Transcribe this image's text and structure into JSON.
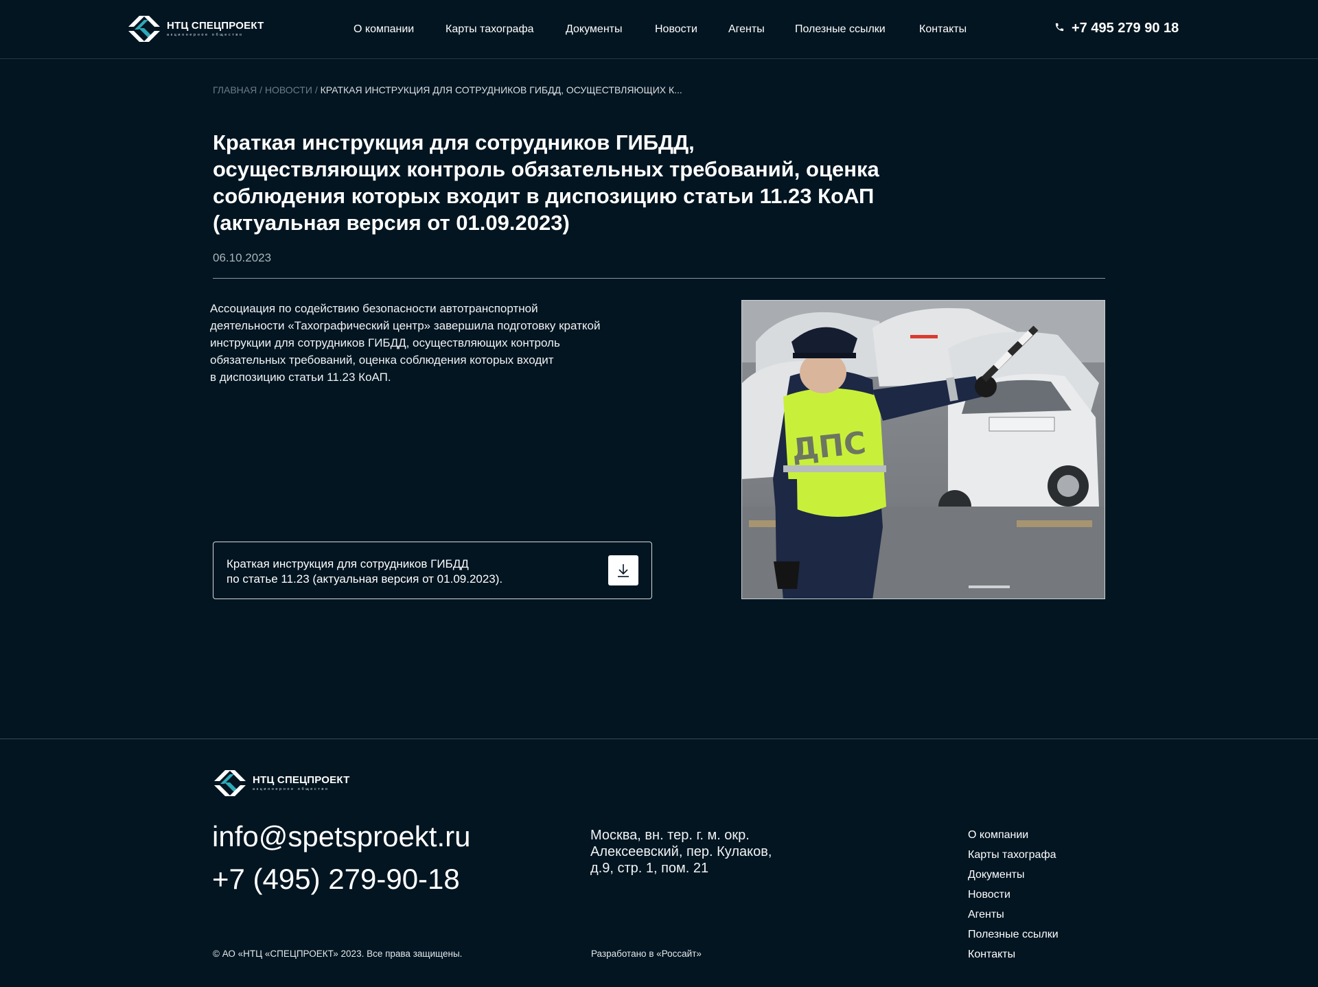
{
  "header": {
    "logo": {
      "title": "НТЦ СПЕЦПРОЕКТ",
      "subtitle": "акционерное общество"
    },
    "nav": [
      {
        "label": "О компании"
      },
      {
        "label": "Карты тахографа"
      },
      {
        "label": "Документы"
      },
      {
        "label": "Новости"
      },
      {
        "label": "Агенты"
      },
      {
        "label": "Полезные ссылки"
      },
      {
        "label": "Контакты"
      }
    ],
    "phone": "+7 495 279 90 18",
    "phone_icon": "phone-icon"
  },
  "breadcrumb": {
    "home": "ГЛАВНАЯ",
    "news": "НОВОСТИ",
    "separator": "/",
    "current": "КРАТКАЯ ИНСТРУКЦИЯ ДЛЯ СОТРУДНИКОВ ГИБДД, ОСУЩЕСТВЛЯЮЩИХ К..."
  },
  "article": {
    "title_lines": [
      "Краткая инструкция для сотрудников ГИБДД,",
      "осуществляющих контроль обязательных требований, оценка",
      "соблюдения которых входит в диспозицию статьи 11.23 КоАП",
      "(актуальная версия от 01.09.2023)"
    ],
    "date": "06.10.2023",
    "body_lines": [
      "Ассоциация по содействию безопасности автотранспортной",
      "деятельности «Тахографический центр» завершила подготовку краткой",
      "инструкции для сотрудников ГИБДД, осуществляющих контроль",
      "обязательных требований, оценка соблюдения которых входит",
      "в диспозицию статьи 11.23 КоАП."
    ],
    "image_vest_text": "ДПС",
    "attachment": {
      "lines": [
        "Краткая инструкция для сотрудников ГИБДД",
        "по статье 11.23 (актуальная версия от 01.09.2023)."
      ],
      "icon": "download-icon"
    }
  },
  "footer": {
    "logo": {
      "title": "НТЦ СПЕЦПРОЕКТ",
      "subtitle": "акционерное общество"
    },
    "email": "info@spetsproekt.ru",
    "phone": "+7 (495) 279-90-18",
    "address_lines": [
      "Москва, вн. тер. г. м. окр.",
      "Алексеевский, пер. Кулаков,",
      "д.9, стр. 1, пом. 21"
    ],
    "nav": [
      {
        "label": "О компании"
      },
      {
        "label": "Карты тахографа"
      },
      {
        "label": "Документы"
      },
      {
        "label": "Новости"
      },
      {
        "label": "Агенты"
      },
      {
        "label": "Полезные ссылки"
      },
      {
        "label": "Контакты"
      }
    ],
    "copyright": "© АО «НТЦ «СПЕЦПРОЕКТ» 2023. Все права защищены.",
    "developer": "Разработано в «Россайт»"
  },
  "colors": {
    "background": "#021521",
    "logo_accent": "#2fa9b8",
    "divider": "#8c979e",
    "vest": "#c8f03a"
  }
}
